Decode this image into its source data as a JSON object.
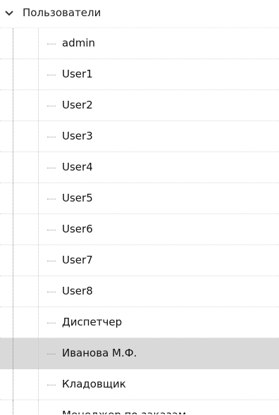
{
  "tree": {
    "root": {
      "label": "Пользователи",
      "icon": "chevron-down-icon",
      "expanded": true
    },
    "items": [
      {
        "label": "admin",
        "selected": false
      },
      {
        "label": "User1",
        "selected": false
      },
      {
        "label": "User2",
        "selected": false
      },
      {
        "label": "User3",
        "selected": false
      },
      {
        "label": "User4",
        "selected": false
      },
      {
        "label": "User5",
        "selected": false
      },
      {
        "label": "User6",
        "selected": false
      },
      {
        "label": "User7",
        "selected": false
      },
      {
        "label": "User8",
        "selected": false
      },
      {
        "label": "Диспетчер",
        "selected": false
      },
      {
        "label": "Иванова М.Ф.",
        "selected": true
      },
      {
        "label": "Кладовщик",
        "selected": false
      },
      {
        "label": "Менеджер по заказам",
        "selected": false
      }
    ],
    "colors": {
      "selection": "#d9d9d9",
      "text": "#1b1b1b",
      "connector": "#8a8a8a"
    }
  }
}
